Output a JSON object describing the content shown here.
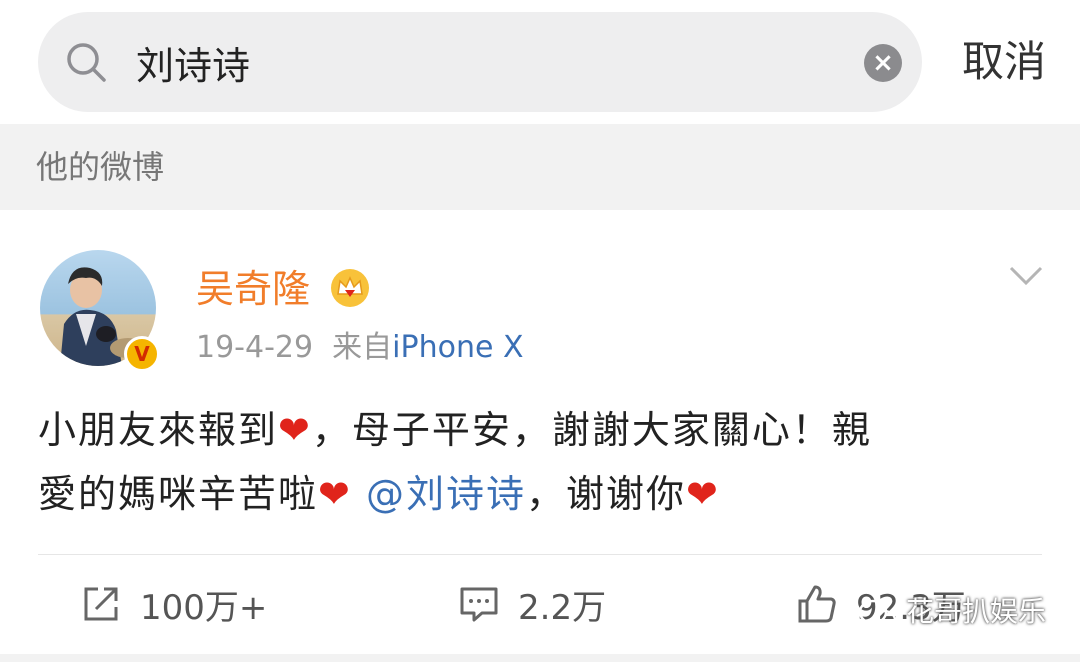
{
  "search": {
    "query": "刘诗诗",
    "cancel_label": "取消"
  },
  "section": {
    "title": "他的微博"
  },
  "post": {
    "author": "吴奇隆",
    "date": "19-4-29",
    "source_prefix": "来自",
    "source": "iPhone X",
    "verified_mark": "V",
    "body": {
      "line1_a": "小朋友來報到",
      "line1_b": "，母子平安，謝謝大家關心！親",
      "line2_a": "愛的媽咪辛苦啦",
      "mention": "@刘诗诗",
      "line2_b": "，谢谢你",
      "heart": "❤"
    },
    "actions": {
      "share_count": "100万+",
      "comment_count": "2.2万",
      "like_count": "92.3万"
    }
  },
  "watermark": {
    "text": "花哥扒娱乐"
  },
  "colors": {
    "author_orange": "#f17d2a",
    "link_blue": "#3a6fb5",
    "heart_red": "#e0241b"
  }
}
